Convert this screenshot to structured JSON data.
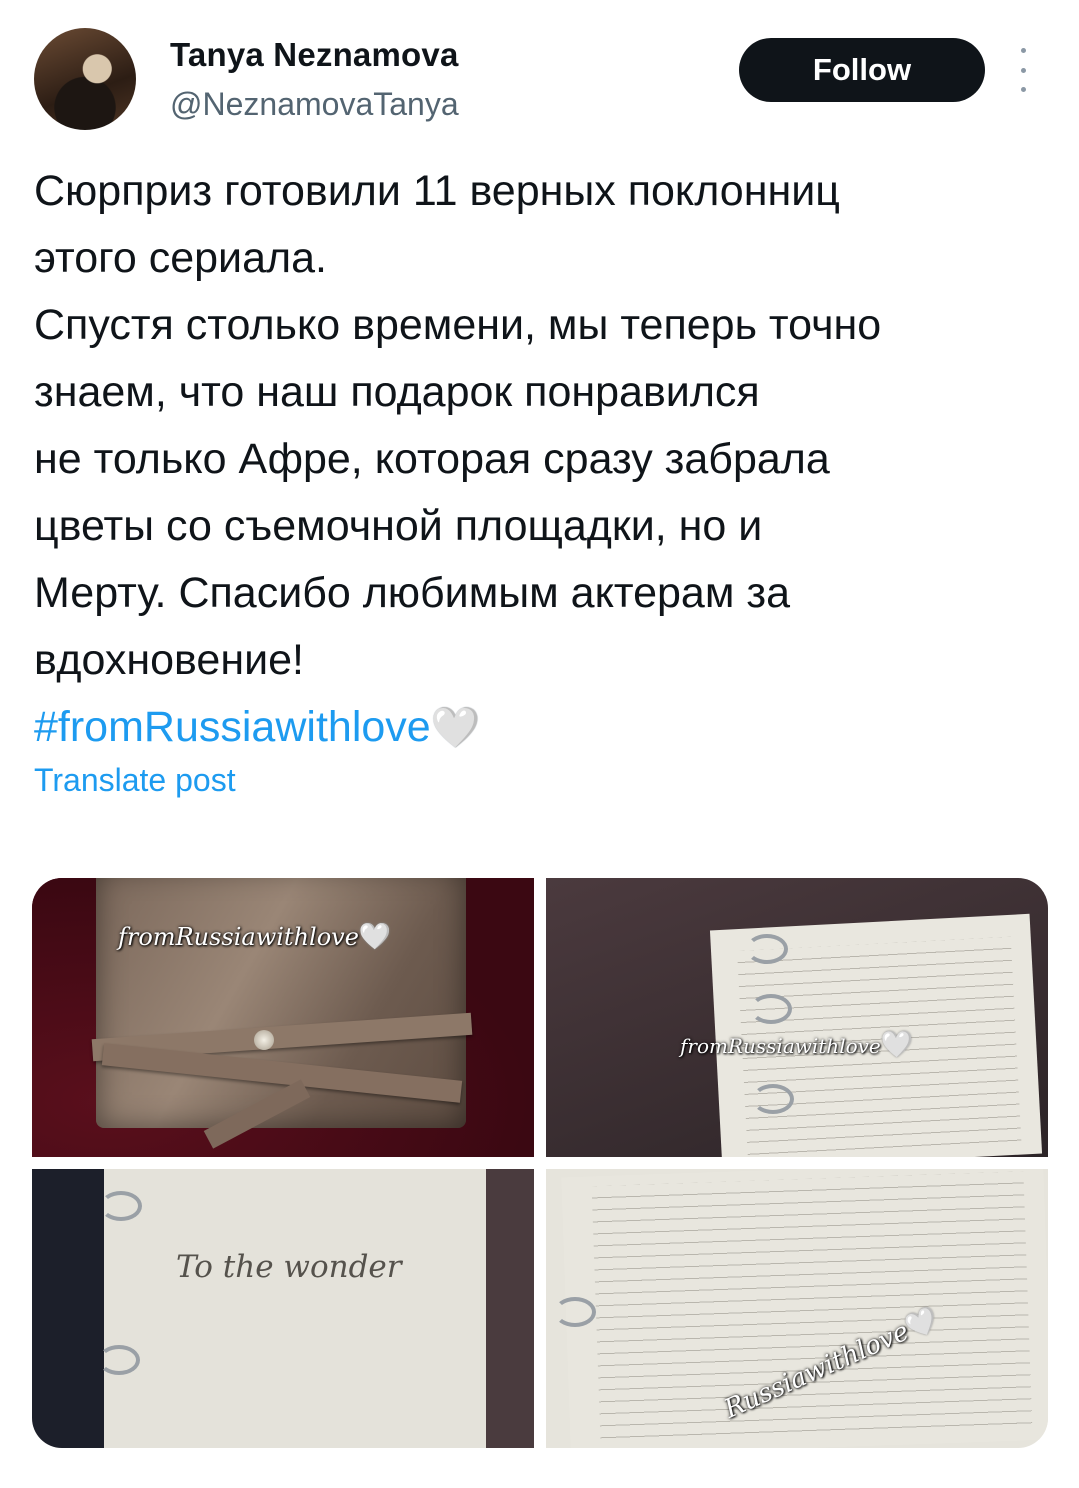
{
  "author": {
    "display_name": "Tanya Neznamova",
    "handle": "@NeznamovaTanya"
  },
  "header": {
    "follow_label": "Follow",
    "more_icon": "more-vertical-icon"
  },
  "post": {
    "text": "Сюрприз готовили 11 верных поклонниц\nэтого сериала.\nСпустя столько времени, мы теперь точно\nзнаем, что наш подарок понравился\nне только Афре, которая сразу забрала\nцветы со съемочной площадки, но и\nМерту. Спасибо любимым актерам за\nвдохновение!",
    "hashtag": "#fromRussiawithlove",
    "emoji": "🤍",
    "translate_label": "Translate post"
  },
  "media": {
    "photos": [
      {
        "name": "leather-journal-photo",
        "watermark": "fromRussiawithlove",
        "heart": "🤍"
      },
      {
        "name": "lined-pages-photo",
        "watermark": "fromRussiawithlove",
        "heart": "🤍"
      },
      {
        "name": "dedication-page-photo",
        "inscription": "To the wonder"
      },
      {
        "name": "blank-pages-photo",
        "watermark": "Russiawithlove",
        "heart": "🤍"
      }
    ]
  },
  "colors": {
    "text": "#0f1419",
    "secondary": "#536471",
    "link": "#1d9bf0",
    "button_bg": "#0f1419"
  }
}
